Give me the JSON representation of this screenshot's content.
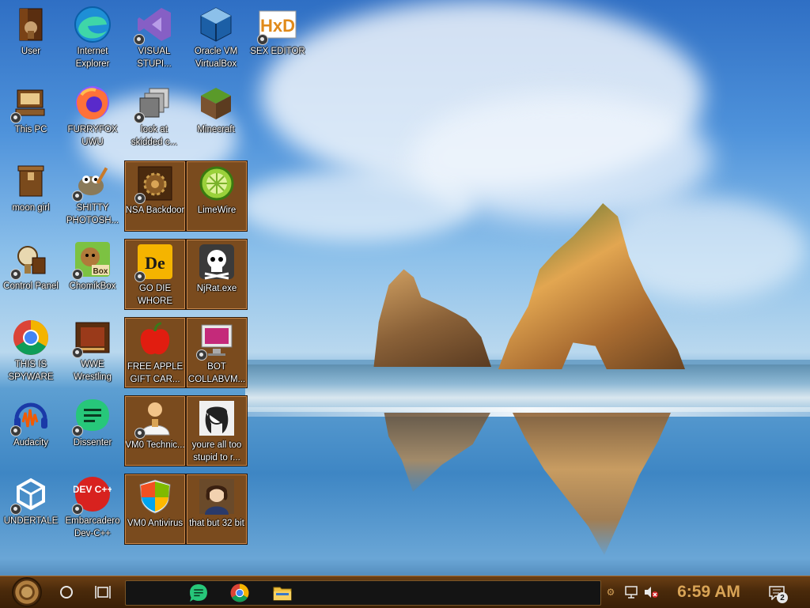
{
  "desktop": {
    "icons": [
      {
        "label": "User"
      },
      {
        "label": "Internet Explorer"
      },
      {
        "label": "VISUAL STUPI..."
      },
      {
        "label": "Oracle VM VirtualBox"
      },
      {
        "label": "SEX EDITOR"
      },
      {
        "label": "This PC"
      },
      {
        "label": "FURRYFOX UWU"
      },
      {
        "label": "look at skidded c..."
      },
      {
        "label": "Minecraft"
      },
      {
        "label": "moon girl"
      },
      {
        "label": "SHITTY PHOTOSH..."
      },
      {
        "label": "NSA Backdoor"
      },
      {
        "label": "LimeWire"
      },
      {
        "label": "Control Panel"
      },
      {
        "label": "ChomikBox"
      },
      {
        "label": "GO DIE WHORE"
      },
      {
        "label": "NjRat.exe"
      },
      {
        "label": "THIS IS SPYWARE"
      },
      {
        "label": "WWE Wrestling"
      },
      {
        "label": "FREE APPLE GIFT CAR..."
      },
      {
        "label": "BOT COLLABVM..."
      },
      {
        "label": "Audacity"
      },
      {
        "label": "Dissenter"
      },
      {
        "label": "VM0 Technic..."
      },
      {
        "label": "youre all too stupid to r..."
      },
      {
        "label": "UNDERTALE"
      },
      {
        "label": "Embarcadero Dev-C++"
      },
      {
        "label": "VM0 Antivirus"
      },
      {
        "label": "that but 32 bit"
      }
    ],
    "icon_glyphs": {
      "dev_cpp": "DEV C++",
      "chomik": "Box",
      "hxd": "HxD",
      "de": "De"
    }
  },
  "taskbar": {
    "clock": "6:59 AM",
    "notifications_count": "2",
    "pinned_apps": [
      "Dissenter",
      "Google Chrome",
      "File Explorer"
    ]
  },
  "colors": {
    "taskbar": "#4a2a0b",
    "accent": "#d9a456",
    "selected_icon_bg": "#7a4b1e"
  }
}
